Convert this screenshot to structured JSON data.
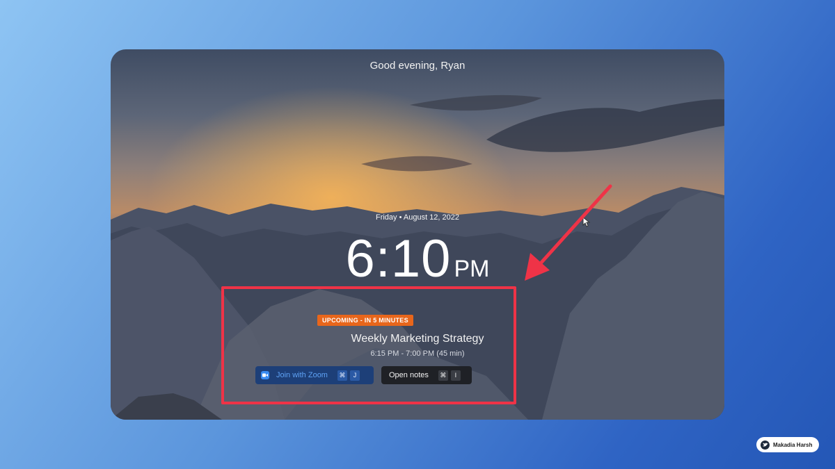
{
  "greeting": "Good evening, Ryan",
  "date": "Friday • August 12, 2022",
  "clock": {
    "time": "6:10",
    "period": "PM"
  },
  "event": {
    "badge": "UPCOMING - IN 5 MINUTES",
    "title": "Weekly Marketing Strategy",
    "time_range": "6:15 PM - 7:00 PM (45 min)",
    "join_button": {
      "label": "Join with Zoom",
      "keys": [
        "⌘",
        "J"
      ],
      "icon": "zoom-video-icon"
    },
    "notes_button": {
      "label": "Open notes",
      "keys": [
        "⌘",
        "I"
      ]
    }
  },
  "credit": {
    "name": "Makadia Harsh",
    "icon": "bird-icon"
  },
  "colors": {
    "highlight": "#ef3347",
    "badge": "#e8661b",
    "zoom_button": "#1d3f78",
    "notes_button": "#1f2126"
  }
}
